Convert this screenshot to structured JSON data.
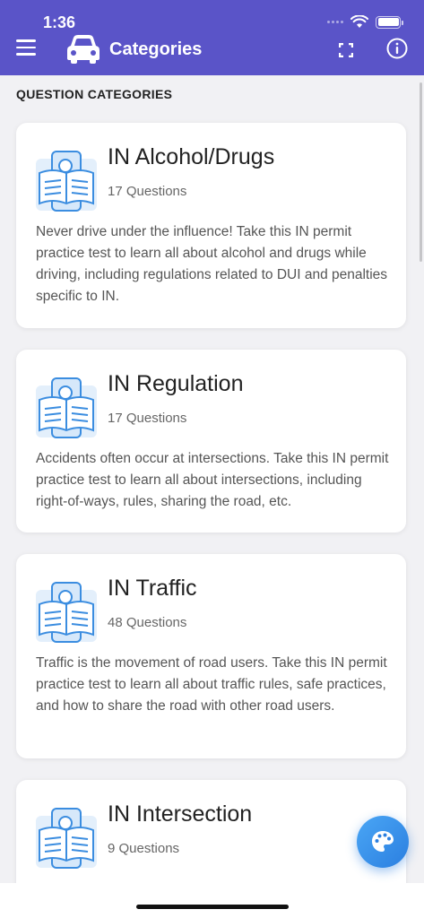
{
  "status_bar": {
    "time": "1:36"
  },
  "header": {
    "title": "Categories",
    "menu_icon": "hamburger-menu-icon",
    "logo_icon": "car-icon",
    "fullscreen_icon": "fullscreen-icon",
    "info_icon": "info-icon",
    "background_color": "#5a54c8"
  },
  "section": {
    "label": "QUESTION CATEGORIES"
  },
  "categories": [
    {
      "title": "IN Alcohol/Drugs",
      "count": "17 Questions",
      "description": "Never drive under the influence! Take this IN permit practice test to learn all about alcohol and drugs while driving, including regulations related to DUI and penalties specific to IN."
    },
    {
      "title": "IN Regulation",
      "count": "17 Questions",
      "description": "Accidents often occur at intersections. Take this IN permit practice test to learn all about intersections, including right-of-ways, rules, sharing the road, etc."
    },
    {
      "title": "IN Traffic",
      "count": "48 Questions",
      "description": "Traffic is the movement of road users. Take this IN permit practice test to learn all about traffic rules, safe practices, and how to share the road with other road users."
    },
    {
      "title": "IN Intersection",
      "count": "9 Questions",
      "description": ""
    }
  ],
  "fab": {
    "icon": "palette-icon",
    "color": "#2b7fe0"
  }
}
